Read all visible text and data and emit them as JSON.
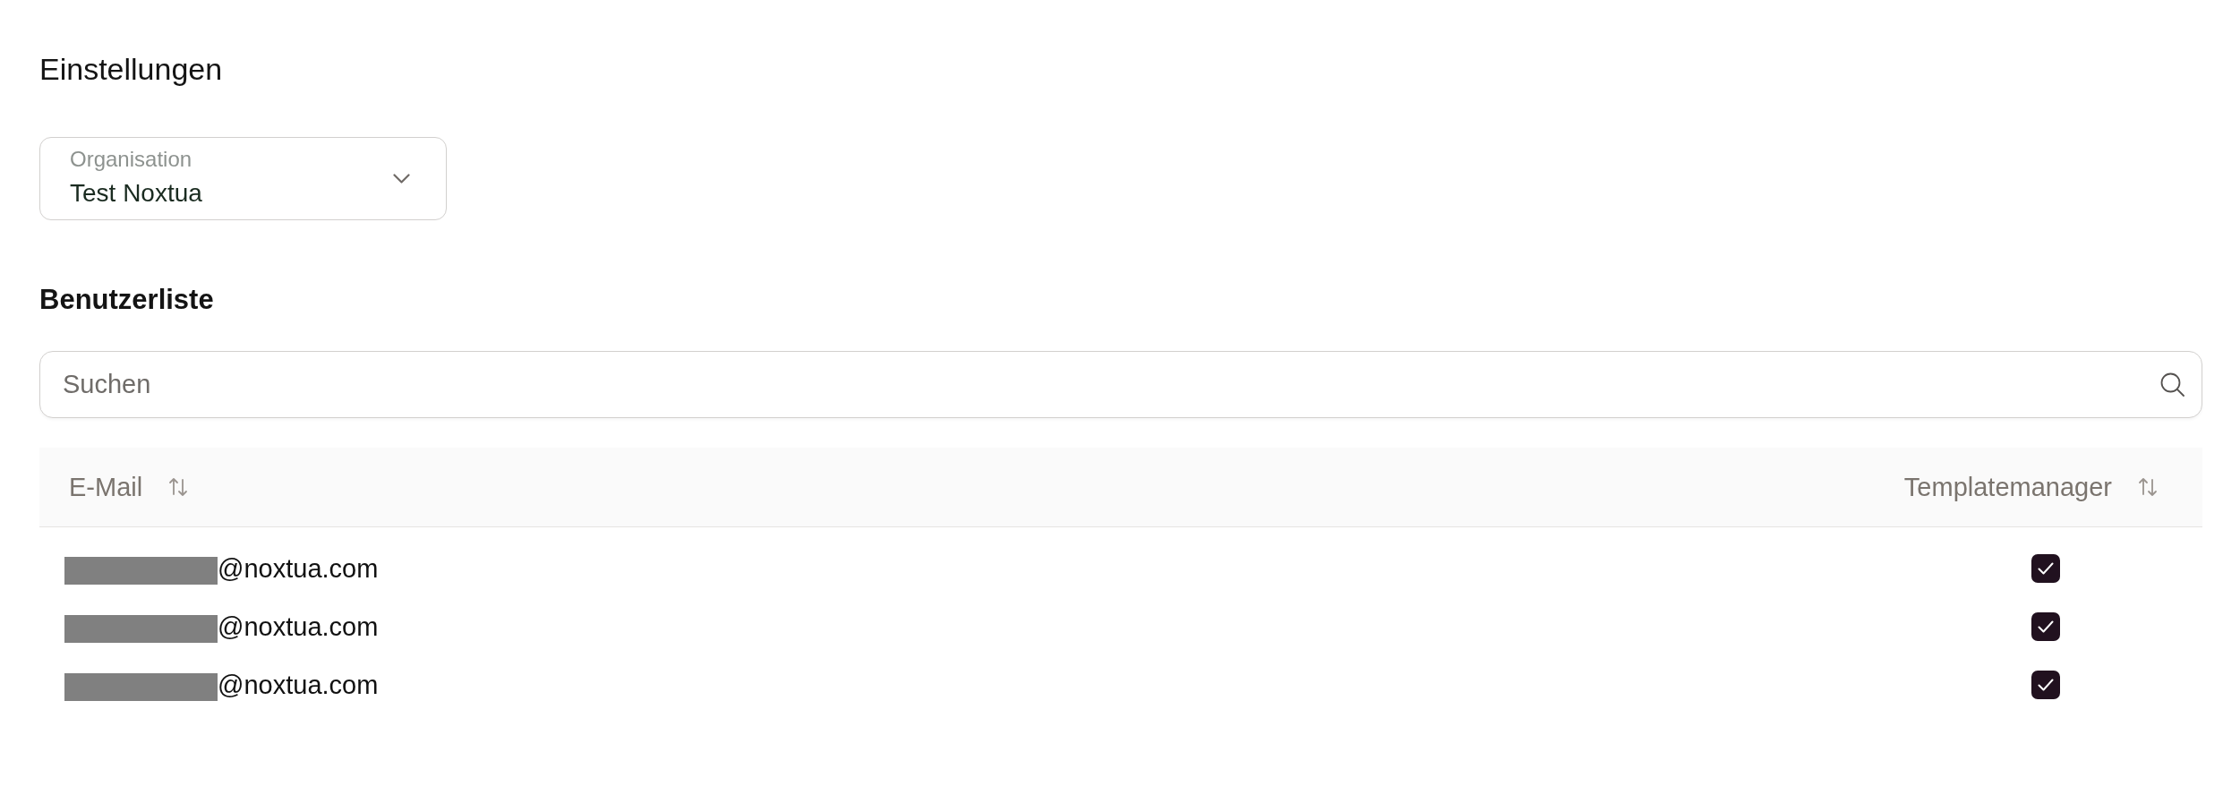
{
  "page": {
    "title": "Einstellungen"
  },
  "organisation_select": {
    "label": "Organisation",
    "value": "Test Noxtua"
  },
  "user_list": {
    "title": "Benutzerliste",
    "search": {
      "placeholder": "Suchen"
    },
    "columns": [
      {
        "label": "E-Mail",
        "sortable": true
      },
      {
        "label": "Templatemanager",
        "sortable": true
      }
    ],
    "rows": [
      {
        "email": "@noxtua.com",
        "redacted": true,
        "checked": true
      },
      {
        "email": "@noxtua.com",
        "redacted": true,
        "checked": true
      },
      {
        "email": "@noxtua.com",
        "redacted": true,
        "checked": true
      }
    ]
  }
}
